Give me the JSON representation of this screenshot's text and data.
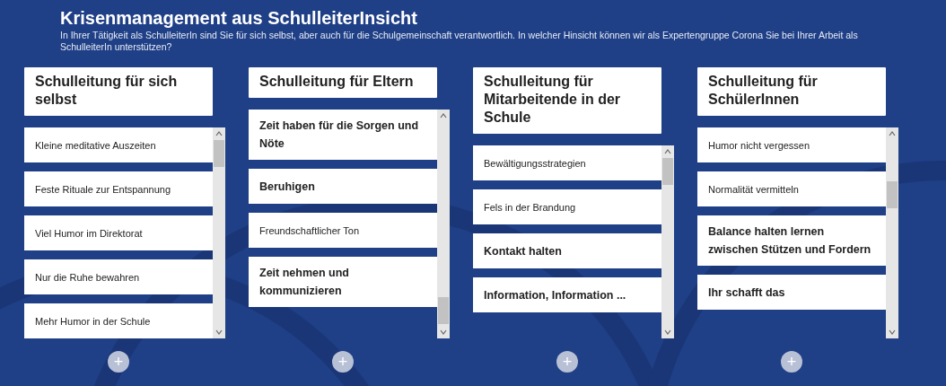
{
  "header": {
    "title": "Krisenmanagement aus SchulleiterInsicht",
    "description": "In Ihrer Tätigkeit als SchulleiterIn sind Sie für sich selbst, aber auch für die Schulgemeinschaft verantwortlich. In welcher Hinsicht können wir als Expertengruppe Corona Sie bei Ihrer Arbeit als SchulleiterIn unterstützen?"
  },
  "columns": [
    {
      "heading": "Schulleitung für sich selbst",
      "add_button": "+",
      "cards": [
        {
          "text": "Kleine meditative Auszeiten",
          "kind": "small"
        },
        {
          "text": "Feste Rituale zur Entspannung",
          "kind": "small"
        },
        {
          "text": "Viel Humor im Direktorat",
          "kind": "small"
        },
        {
          "text": "Nur die Ruhe bewahren",
          "kind": "small"
        },
        {
          "text": "Mehr Humor in der Schule",
          "kind": "small"
        }
      ]
    },
    {
      "heading": "Schulleitung für Eltern",
      "add_button": "+",
      "cards": [
        {
          "text": "Zeit haben für die Sorgen und Nöte",
          "kind": "large"
        },
        {
          "text": "Beruhigen",
          "kind": "large"
        },
        {
          "text": "Freundschaftlicher Ton",
          "kind": "small"
        },
        {
          "text": "Zeit nehmen und kommunizieren",
          "kind": "large"
        }
      ]
    },
    {
      "heading": "Schulleitung für Mitarbeitende in der Schule",
      "add_button": "+",
      "cards": [
        {
          "text": "Bewältigungsstrategien",
          "kind": "small"
        },
        {
          "text": "Fels in der Brandung",
          "kind": "small"
        },
        {
          "text": "Kontakt halten",
          "kind": "large"
        },
        {
          "text": "Information, Information ...",
          "kind": "large"
        }
      ]
    },
    {
      "heading": "Schulleitung für SchülerInnen",
      "add_button": "+",
      "cards": [
        {
          "text": "Humor nicht vergessen",
          "kind": "small"
        },
        {
          "text": "Normalität vermitteln",
          "kind": "small"
        },
        {
          "text": "Balance halten lernen zwischen Stützen und Fordern",
          "kind": "large"
        },
        {
          "text": "Ihr schafft das",
          "kind": "large"
        }
      ]
    }
  ]
}
